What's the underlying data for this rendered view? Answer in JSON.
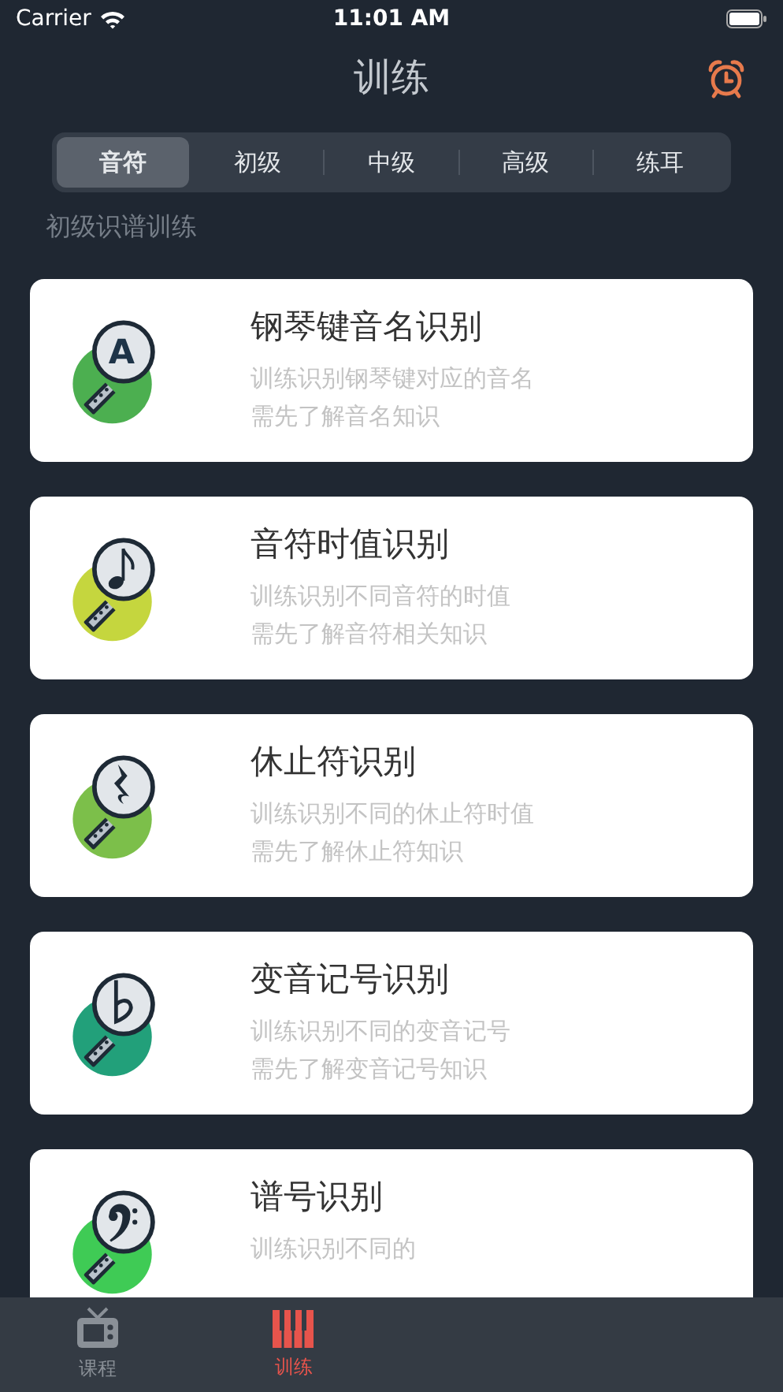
{
  "status_bar": {
    "carrier": "Carrier",
    "time": "11:01 AM"
  },
  "nav": {
    "title": "训练"
  },
  "segments": [
    {
      "label": "音符",
      "selected": true
    },
    {
      "label": "初级",
      "selected": false
    },
    {
      "label": "中级",
      "selected": false
    },
    {
      "label": "高级",
      "selected": false
    },
    {
      "label": "练耳",
      "selected": false
    }
  ],
  "section_title": "初级识谱训练",
  "cards": [
    {
      "title": "钢琴键音名识别",
      "lines": [
        "训练识别钢琴键对应的音名",
        "需先了解音名知识"
      ],
      "color": "#4caf50",
      "glyph": {
        "kind": "letter",
        "text": "A"
      }
    },
    {
      "title": "音符时值识别",
      "lines": [
        "训练识别不同音符的时值",
        "需先了解音符相关知识"
      ],
      "color": "#c5d63e",
      "glyph": {
        "kind": "note"
      }
    },
    {
      "title": "休止符识别",
      "lines": [
        "训练识别不同的休止符时值",
        "需先了解休止符知识"
      ],
      "color": "#7cbf4a",
      "glyph": {
        "kind": "rest"
      }
    },
    {
      "title": "变音记号识别",
      "lines": [
        "训练识别不同的变音记号",
        "需先了解变音记号知识"
      ],
      "color": "#22a07a",
      "glyph": {
        "kind": "flat"
      }
    },
    {
      "title": "谱号识别",
      "lines": [
        "训练识别不同的"
      ],
      "color": "#3fcb55",
      "glyph": {
        "kind": "clef"
      }
    }
  ],
  "tab_bar": [
    {
      "label": "课程",
      "kind": "tv",
      "selected": false
    },
    {
      "label": "训练",
      "kind": "piano",
      "selected": true
    }
  ]
}
